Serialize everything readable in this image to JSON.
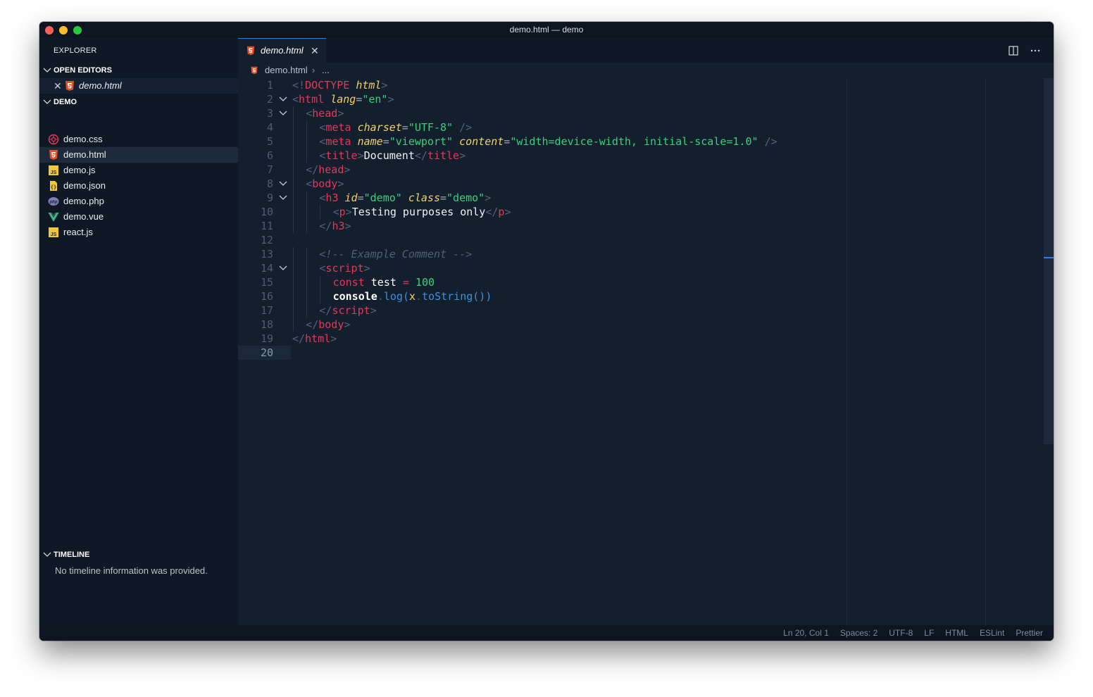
{
  "window": {
    "title": "demo.html — demo"
  },
  "sidebar": {
    "title": "EXPLORER",
    "open_editors": {
      "label": "OPEN EDITORS",
      "items": [
        {
          "label": "demo.html",
          "icon": "html5-icon"
        }
      ]
    },
    "folder": {
      "label": "DEMO",
      "files": [
        {
          "label": "demo.css",
          "icon": "css-icon"
        },
        {
          "label": "demo.html",
          "icon": "html5-icon",
          "selected": true
        },
        {
          "label": "demo.js",
          "icon": "js-icon"
        },
        {
          "label": "demo.json",
          "icon": "json-icon"
        },
        {
          "label": "demo.php",
          "icon": "php-icon"
        },
        {
          "label": "demo.vue",
          "icon": "vue-icon"
        },
        {
          "label": "react.js",
          "icon": "js-icon"
        }
      ]
    },
    "timeline": {
      "label": "TIMELINE",
      "message": "No timeline information was provided."
    }
  },
  "editor": {
    "tab": {
      "label": "demo.html"
    },
    "breadcrumb": {
      "file": "demo.html",
      "more": "..."
    },
    "lines": [
      [
        [
          "c-punc",
          "<!"
        ],
        [
          "c-kw",
          "DOCTYPE"
        ],
        [
          "c-text",
          " "
        ],
        [
          "c-attr",
          "html"
        ],
        [
          "c-punc",
          ">"
        ]
      ],
      [
        [
          "c-punc",
          "<"
        ],
        [
          "c-tag",
          "html"
        ],
        [
          "c-text",
          " "
        ],
        [
          "c-attr",
          "lang"
        ],
        [
          "c-eq",
          "="
        ],
        [
          "c-str",
          "\"en\""
        ],
        [
          "c-punc",
          ">"
        ]
      ],
      [
        [
          "c-punc",
          "<"
        ],
        [
          "c-tag",
          "head"
        ],
        [
          "c-punc",
          ">"
        ]
      ],
      [
        [
          "c-punc",
          "<"
        ],
        [
          "c-tag",
          "meta"
        ],
        [
          "c-text",
          " "
        ],
        [
          "c-attr",
          "charset"
        ],
        [
          "c-eq",
          "="
        ],
        [
          "c-str",
          "\"UTF-8\""
        ],
        [
          "c-text",
          " "
        ],
        [
          "c-punc",
          "/>"
        ]
      ],
      [
        [
          "c-punc",
          "<"
        ],
        [
          "c-tag",
          "meta"
        ],
        [
          "c-text",
          " "
        ],
        [
          "c-attr",
          "name"
        ],
        [
          "c-eq",
          "="
        ],
        [
          "c-str",
          "\"viewport\""
        ],
        [
          "c-text",
          " "
        ],
        [
          "c-attr",
          "content"
        ],
        [
          "c-eq",
          "="
        ],
        [
          "c-str",
          "\"width=device-width, initial-scale=1.0\""
        ],
        [
          "c-text",
          " "
        ],
        [
          "c-punc",
          "/>"
        ]
      ],
      [
        [
          "c-punc",
          "<"
        ],
        [
          "c-tag",
          "title"
        ],
        [
          "c-punc",
          ">"
        ],
        [
          "c-text",
          "Document"
        ],
        [
          "c-punc",
          "</"
        ],
        [
          "c-tag",
          "title"
        ],
        [
          "c-punc",
          ">"
        ]
      ],
      [
        [
          "c-punc",
          "</"
        ],
        [
          "c-tag",
          "head"
        ],
        [
          "c-punc",
          ">"
        ]
      ],
      [
        [
          "c-punc",
          "<"
        ],
        [
          "c-tag",
          "body"
        ],
        [
          "c-punc",
          ">"
        ]
      ],
      [
        [
          "c-punc",
          "<"
        ],
        [
          "c-tag",
          "h3"
        ],
        [
          "c-text",
          " "
        ],
        [
          "c-attr",
          "id"
        ],
        [
          "c-eq",
          "="
        ],
        [
          "c-str",
          "\"demo\""
        ],
        [
          "c-text",
          " "
        ],
        [
          "c-attr",
          "class"
        ],
        [
          "c-eq",
          "="
        ],
        [
          "c-str",
          "\"demo\""
        ],
        [
          "c-punc",
          ">"
        ]
      ],
      [
        [
          "c-punc",
          "<"
        ],
        [
          "c-tag",
          "p"
        ],
        [
          "c-punc",
          ">"
        ],
        [
          "c-text",
          "Testing purposes only"
        ],
        [
          "c-punc",
          "</"
        ],
        [
          "c-tag",
          "p"
        ],
        [
          "c-punc",
          ">"
        ]
      ],
      [
        [
          "c-punc",
          "</"
        ],
        [
          "c-tag",
          "h3"
        ],
        [
          "c-punc",
          ">"
        ]
      ],
      [],
      [
        [
          "c-comment",
          "<!-- Example Comment -->"
        ]
      ],
      [
        [
          "c-punc",
          "<"
        ],
        [
          "c-tag",
          "script"
        ],
        [
          "c-punc",
          ">"
        ]
      ],
      [
        [
          "c-kw",
          "const"
        ],
        [
          "c-text",
          " "
        ],
        [
          "c-ident",
          "test"
        ],
        [
          "c-text",
          " "
        ],
        [
          "c-kw",
          "="
        ],
        [
          "c-text",
          " "
        ],
        [
          "c-num",
          "100"
        ]
      ],
      [
        [
          "c-obj",
          "console"
        ],
        [
          "c-punc",
          "."
        ],
        [
          "c-fn",
          "log"
        ],
        [
          "c-fn",
          "("
        ],
        [
          "c-var",
          "x"
        ],
        [
          "c-punc",
          "."
        ],
        [
          "c-fn",
          "toString"
        ],
        [
          "c-fn",
          "())"
        ]
      ],
      [
        [
          "c-punc",
          "</"
        ],
        [
          "c-tag",
          "script"
        ],
        [
          "c-punc",
          ">"
        ]
      ],
      [
        [
          "c-punc",
          "</"
        ],
        [
          "c-tag",
          "body"
        ],
        [
          "c-punc",
          ">"
        ]
      ],
      [
        [
          "c-punc",
          "</"
        ],
        [
          "c-tag",
          "html"
        ],
        [
          "c-punc",
          ">"
        ]
      ],
      []
    ],
    "current_line": 20,
    "folded_lines": [
      2,
      3,
      8,
      9,
      14
    ]
  },
  "status": {
    "position": "Ln 20, Col 1",
    "spaces": "Spaces: 2",
    "encoding": "UTF-8",
    "eol": "LF",
    "language": "HTML",
    "linter": "ESLint",
    "formatter": "Prettier"
  },
  "colors": {
    "accent": "#2f7ed8",
    "background": "#141f2e",
    "sidebar": "#0f1925"
  }
}
